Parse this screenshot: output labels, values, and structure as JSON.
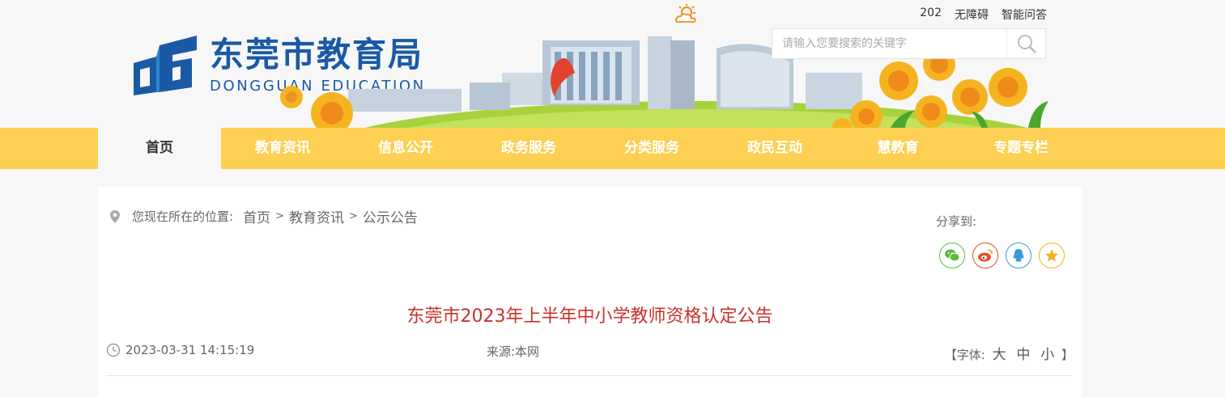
{
  "site": {
    "name_cn": "东莞市教育局",
    "name_en": "DONGGUAN EDUCATION"
  },
  "toplinks": [
    "202",
    "无障碍",
    "智能问答"
  ],
  "search": {
    "placeholder": "请输入您要搜索的关键字"
  },
  "nav": [
    "首页",
    "教育资讯",
    "信息公开",
    "政务服务",
    "分类服务",
    "政民互动",
    "慧教育",
    "专题专栏"
  ],
  "breadcrumb": {
    "prefix": "您现在所在的位置:",
    "items": [
      "首页",
      "教育资讯",
      "公示公告"
    ],
    "separator": ">"
  },
  "share": {
    "label": "分享到:",
    "icons": [
      "wechat-icon",
      "weibo-icon",
      "qq-icon",
      "favorite-icon"
    ]
  },
  "article": {
    "title": "东莞市2023年上半年中小学教师资格认定公告",
    "date": "2023-03-31 14:15:19",
    "source": "来源:本网",
    "font_label_open": "【字体:",
    "font_sizes": [
      "大",
      "中",
      "小"
    ],
    "font_label_close": "】"
  },
  "colors": {
    "brand_blue": "#1a5aa5",
    "nav_yellow": "#fdcf52",
    "title_red": "#c8322c"
  }
}
